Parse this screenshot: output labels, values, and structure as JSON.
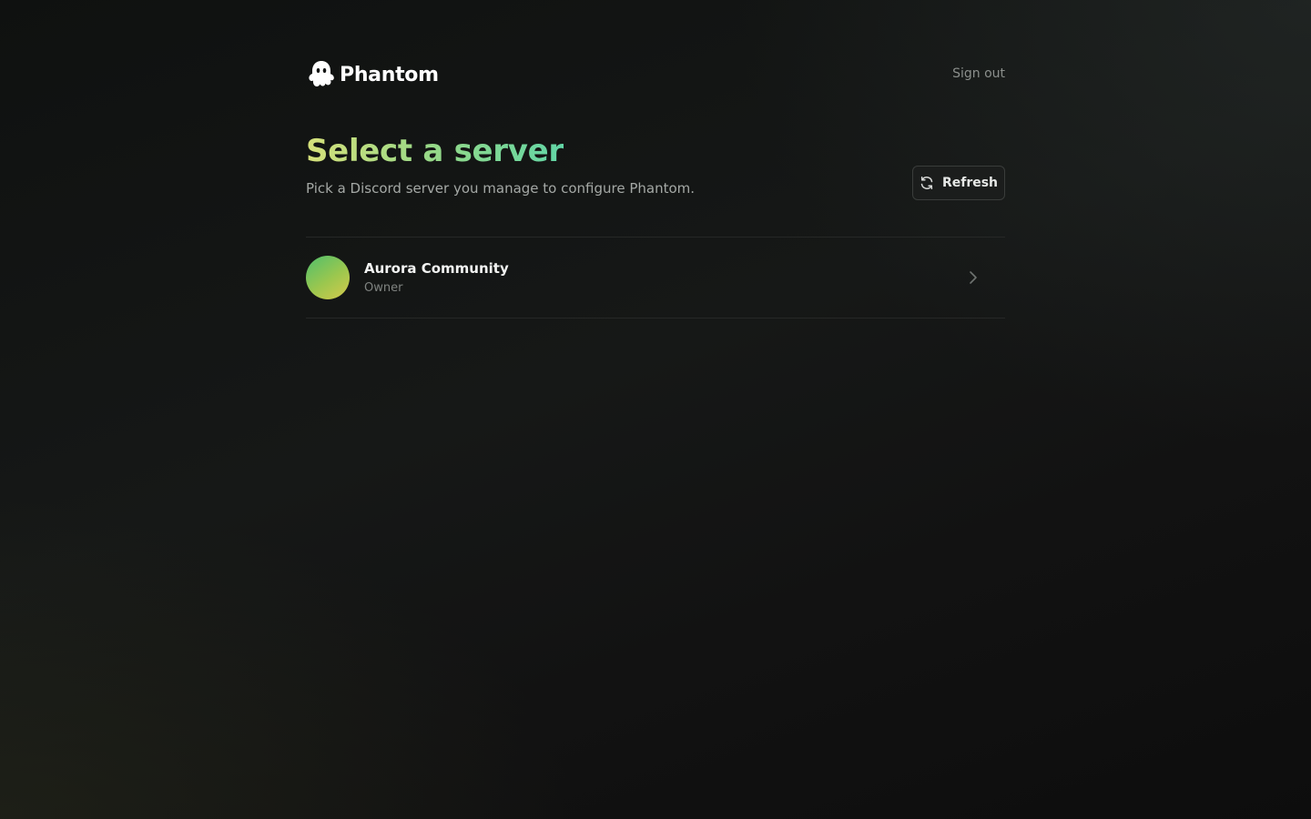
{
  "brand": {
    "name": "Phantom",
    "icon": "ghost-icon"
  },
  "header": {
    "signout_label": "Sign out"
  },
  "page": {
    "title": "Select a server",
    "subtitle": "Pick a Discord server you manage to configure Phantom.",
    "refresh_label": "Refresh",
    "refresh_icon": "refresh-icon"
  },
  "servers": [
    {
      "name": "Aurora Community",
      "role": "Owner"
    }
  ],
  "colors": {
    "title_gradient_start": "#d6e07a",
    "title_gradient_end": "#62d6a6",
    "avatar_gradient_start": "#4fbf6c",
    "avatar_gradient_end": "#d6c94c",
    "background": "#141615"
  }
}
